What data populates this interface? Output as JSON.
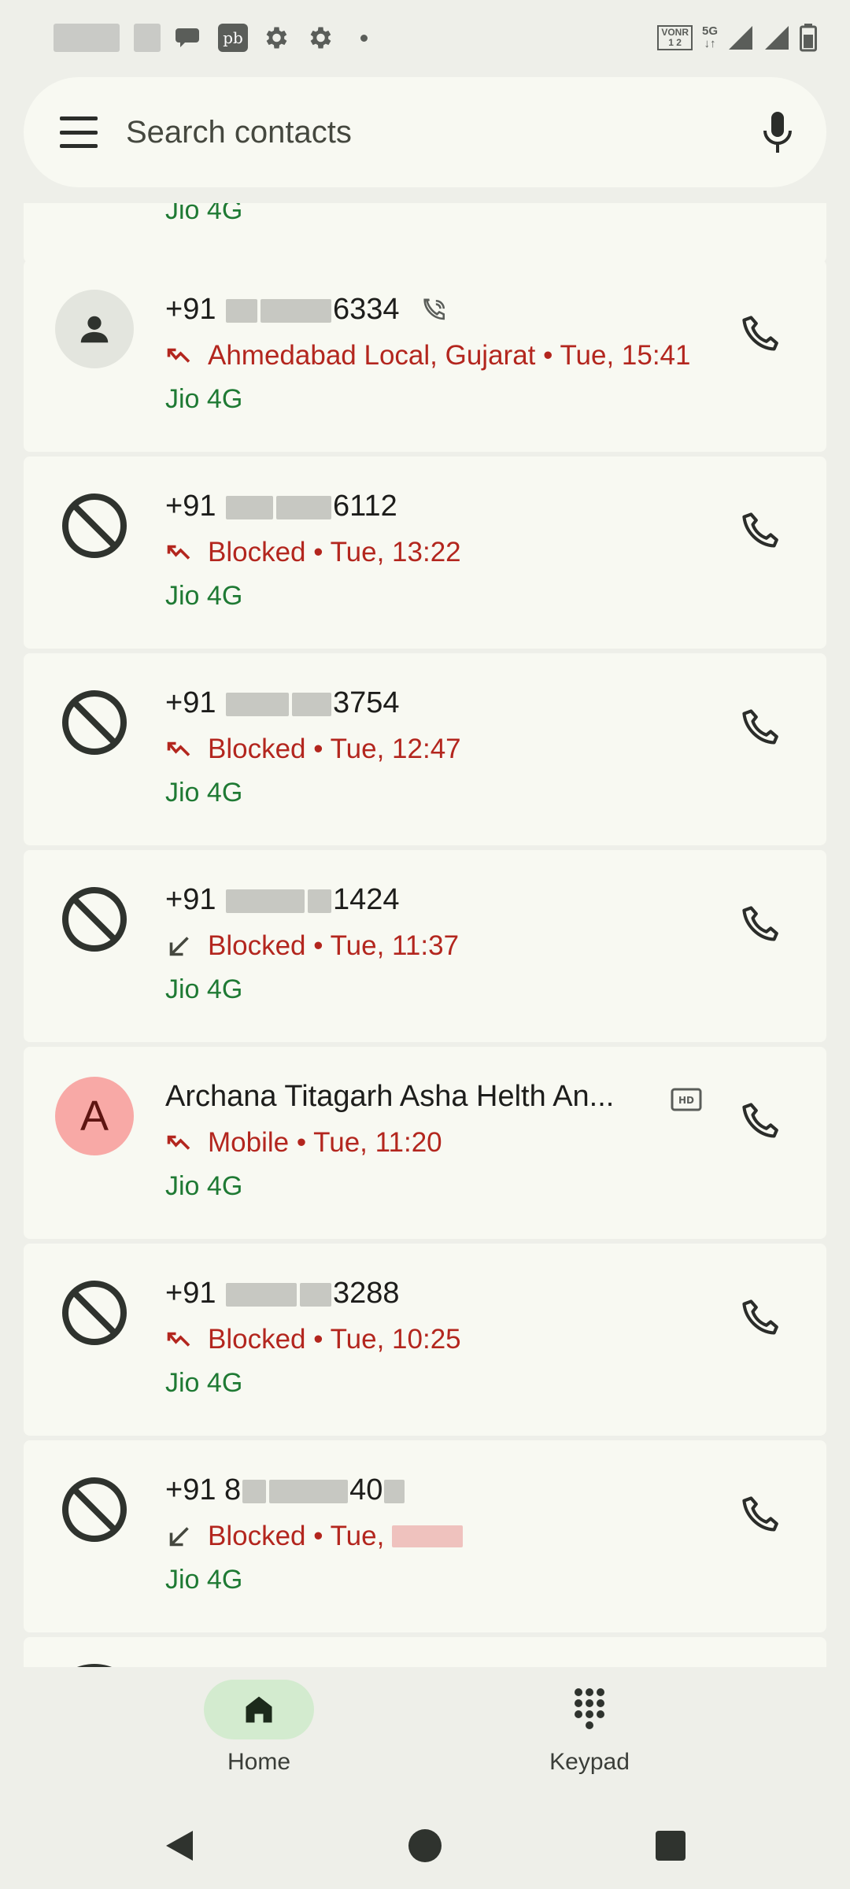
{
  "status_bar": {
    "app_badge": "pb",
    "vonr_label": "VONR",
    "vonr_sub": "1 2",
    "network": "5G"
  },
  "search": {
    "placeholder": "Search contacts"
  },
  "calls": [
    {
      "name_prefix": "+91",
      "name_suffix": "6334",
      "detail": "Ahmedabad Local, Gujarat • Tue, 15:41",
      "carrier": "Jio 4G",
      "avatar": "person-icon",
      "direction": "missed",
      "extra": "wifi-call-icon"
    },
    {
      "name_prefix": "+91",
      "name_suffix": "6112",
      "detail": "Blocked • Tue, 13:22",
      "carrier": "Jio 4G",
      "avatar": "blocked-icon",
      "direction": "missed"
    },
    {
      "name_prefix": "+91",
      "name_suffix": "3754",
      "detail": "Blocked • Tue, 12:47",
      "carrier": "Jio 4G",
      "avatar": "blocked-icon",
      "direction": "missed"
    },
    {
      "name_prefix": "+91",
      "name_suffix": "1424",
      "detail": "Blocked • Tue, 11:37",
      "carrier": "Jio 4G",
      "avatar": "blocked-icon",
      "direction": "incoming"
    },
    {
      "name": "Archana Titagarh Asha Helth An...",
      "detail": "Mobile • Tue, 11:20",
      "carrier": "Jio 4G",
      "avatar_letter": "A",
      "avatar_color": "#f8a9a6",
      "direction": "missed",
      "extra": "hd-icon"
    },
    {
      "name_prefix": "+91",
      "name_suffix": "3288",
      "detail": "Blocked • Tue, 10:25",
      "carrier": "Jio 4G",
      "avatar": "blocked-icon",
      "direction": "missed"
    },
    {
      "name_prefix": "+91 8",
      "name_suffix": "40",
      "detail": "Blocked • Tue,",
      "carrier": "Jio 4G",
      "avatar": "blocked-icon",
      "direction": "incoming"
    }
  ],
  "partial_top_carrier": "Jio 4G",
  "nav": {
    "home_label": "Home",
    "keypad_label": "Keypad"
  },
  "colors": {
    "missed": "#b3261e",
    "carrier": "#1f7a34",
    "nav_active": "#d3ebcf",
    "card_bg": "#f8f9f2"
  }
}
